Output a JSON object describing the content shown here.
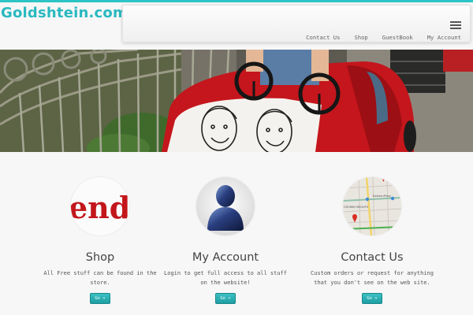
{
  "site": {
    "logo": "Goldshtein.com"
  },
  "nav": {
    "items": [
      {
        "label": "Contact Us"
      },
      {
        "label": "Shop"
      },
      {
        "label": "GuestBook"
      },
      {
        "label": "My Account"
      }
    ]
  },
  "features": [
    {
      "icon": "shop-logo-icon",
      "logo_text": "end",
      "title": "Shop",
      "text": "All Free stuff can be found in the store.",
      "button": "Go »"
    },
    {
      "icon": "user-silhouette-icon",
      "title": "My Account",
      "text": "Login to get full access to all stuff on the website!",
      "button": "Go »"
    },
    {
      "icon": "map-icon",
      "map_labels": [
        "EasternPkwy",
        "CROWN HEIGHTS"
      ],
      "title": "Contact Us",
      "text": "Custom orders or request for anything that you don't see on the web site.",
      "button": "Go »"
    }
  ],
  "colors": {
    "accent": "#2ab9c0",
    "button": "#27a9ac",
    "background": "#f7f7f7"
  }
}
